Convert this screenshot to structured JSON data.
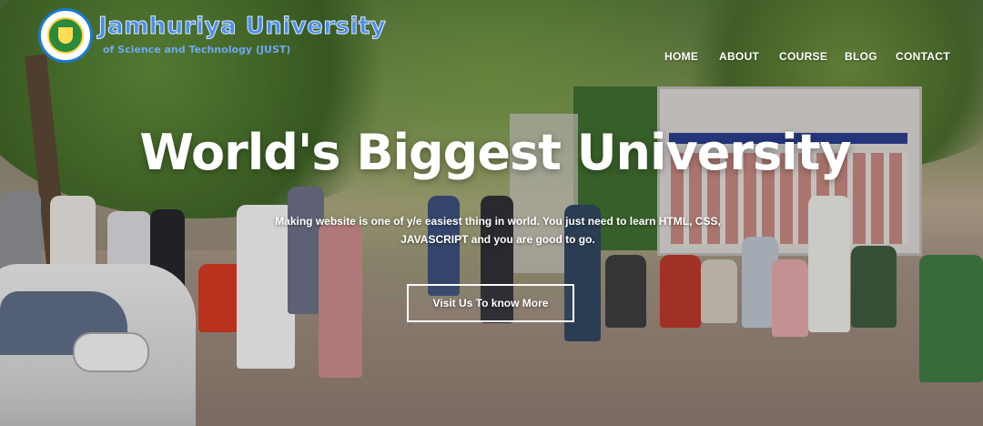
{
  "brand": {
    "name": "Jamhuriya University",
    "tagline": "of Science and Technology (JUST)",
    "logo_icon": "university-seal-icon"
  },
  "nav": {
    "items": [
      {
        "label": "HOME"
      },
      {
        "label": "ABOUT"
      },
      {
        "label": "COURSE"
      },
      {
        "label": "BLOG"
      },
      {
        "label": "CONTACT"
      }
    ]
  },
  "hero": {
    "title": "World's Biggest University",
    "description_line1": "Making website is one of y/e easiest thing in world. You just need to learn HTML, CSS,",
    "description_line2": "JAVASCRIPT and you are good to go.",
    "cta_label": "Visit Us To know More"
  },
  "colors": {
    "brand_blue": "#4c8de6",
    "text_white": "#ffffff"
  }
}
